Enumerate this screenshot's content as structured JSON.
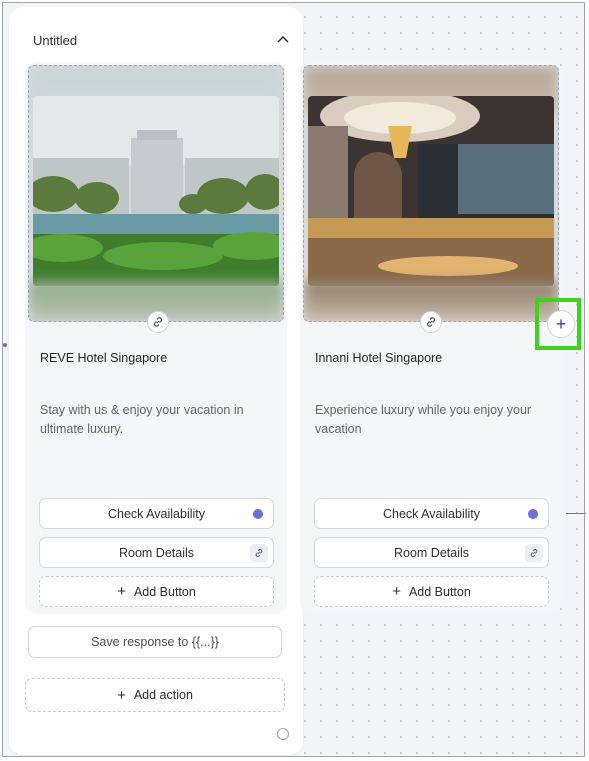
{
  "panel": {
    "title": "Untitled"
  },
  "cards": [
    {
      "title": "REVE Hotel Singapore",
      "description": "Stay with us & enjoy your vacation in ultimate luxury.",
      "buttons": [
        {
          "label": "Check Availability",
          "indicator": "dot"
        },
        {
          "label": "Room Details",
          "indicator": "link-icon"
        }
      ],
      "add_button_label": "Add Button"
    },
    {
      "title": "Innani Hotel Singapore",
      "description": "Experience luxury while you enjoy your vacation",
      "buttons": [
        {
          "label": "Check Availability",
          "indicator": "dot"
        },
        {
          "label": "Room Details",
          "indicator": "link-icon"
        }
      ],
      "add_button_label": "Add Button"
    }
  ],
  "save_response_label": "Save response to  {{...}}",
  "add_action_label": "Add action",
  "colors": {
    "accent": "#6c6ed8",
    "highlight": "#3fd21c",
    "add_icon": "#3a3cc4"
  },
  "icons": [
    "chevron-up-icon",
    "link-icon",
    "plus-icon"
  ]
}
